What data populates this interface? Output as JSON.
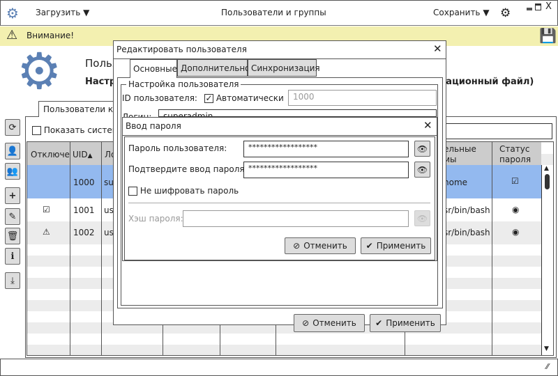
{
  "header": {
    "load_label": "Загрузить",
    "title": "Пользователи и группы",
    "save_label": "Сохранить"
  },
  "warning": {
    "text": "Внимание!"
  },
  "module": {
    "title": "Польз",
    "subtitle": "Настро",
    "subtitle_right": "рационный файл)"
  },
  "tab": {
    "label": "Пользователи ко"
  },
  "filter": {
    "show_system_label": "Показать систем"
  },
  "table": {
    "headers": [
      "Отключен",
      "UID",
      "Ло",
      "",
      "",
      "",
      "ельные\nмы",
      "Статус пароля"
    ],
    "rows": [
      {
        "disabled": "",
        "uid": "1000",
        "login": "su",
        "shell": "home",
        "status": "checkbox",
        "selected": true
      },
      {
        "disabled": "check",
        "uid": "1001",
        "login": "us",
        "shell": "sr/bin/bash",
        "status": "radio"
      },
      {
        "disabled": "warning",
        "uid": "1002",
        "login": "us",
        "shell": "sr/bin/bash",
        "status": "radio"
      }
    ],
    "sort": "UID ascending"
  },
  "edit_dialog": {
    "title": "Редактировать пользователя",
    "tabs": [
      "Основные",
      "Дополнительно",
      "Синхронизация"
    ],
    "active_tab": 0,
    "group_title": "Настройка пользователя",
    "uid_label": "ID пользователя:",
    "auto_label": "Автоматически",
    "auto_checked": true,
    "uid_value": "1000",
    "login_label": "Логин:",
    "login_value": "superadmin",
    "cancel": "Отменить",
    "apply": "Применить"
  },
  "password_dialog": {
    "title": "Ввод пароля",
    "password_label": "Пароль пользователя:",
    "password_value": "******************",
    "confirm_label": "Подтвердите ввод пароля:",
    "confirm_value": "******************",
    "no_encrypt_label": "Не шифровать пароль",
    "hash_label": "Хэш пароля:",
    "hash_value": "",
    "cancel": "Отменить",
    "apply": "Применить"
  },
  "colors": {
    "accent": "#5b80b4",
    "selection": "#93b9ef",
    "warning_bg": "#f3f0b0",
    "header_bg": "#cccccc",
    "button_bg": "#dddddd"
  }
}
